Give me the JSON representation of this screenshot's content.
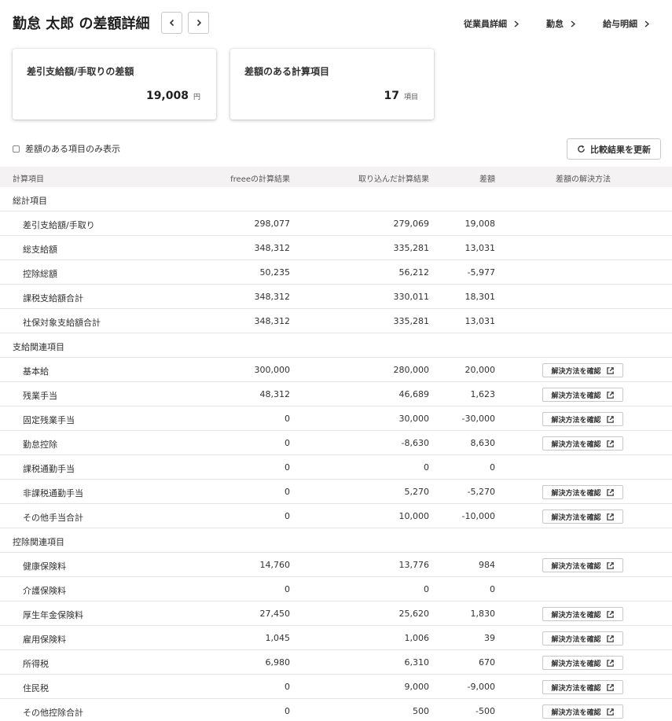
{
  "header": {
    "title": "勤怠 太郎 の差額詳細",
    "links": [
      "従業員詳細",
      "勤怠",
      "給与明細"
    ]
  },
  "cards": [
    {
      "label": "差引支給額/手取りの差額",
      "value": "19,008",
      "unit": "円"
    },
    {
      "label": "差額のある計算項目",
      "value": "17",
      "unit": "項目"
    }
  ],
  "filter": {
    "label": "差額のある項目のみ表示"
  },
  "refresh": {
    "label": "比較結果を更新"
  },
  "table": {
    "headers": [
      "計算項目",
      "freeeの計算結果",
      "取り込んだ計算結果",
      "差額",
      "差額の解決方法"
    ],
    "resolve_label": "解決方法を確認",
    "rows": [
      {
        "type": "group",
        "label": "総計項目"
      },
      {
        "type": "item",
        "label": "差引支給額/手取り",
        "freee": "298,077",
        "imported": "279,069",
        "diff": "19,008",
        "resolve": false
      },
      {
        "type": "item",
        "label": "総支給額",
        "freee": "348,312",
        "imported": "335,281",
        "diff": "13,031",
        "resolve": false
      },
      {
        "type": "item",
        "label": "控除総額",
        "freee": "50,235",
        "imported": "56,212",
        "diff": "-5,977",
        "resolve": false
      },
      {
        "type": "item",
        "label": "課税支給額合計",
        "freee": "348,312",
        "imported": "330,011",
        "diff": "18,301",
        "resolve": false
      },
      {
        "type": "item",
        "label": "社保対象支給額合計",
        "freee": "348,312",
        "imported": "335,281",
        "diff": "13,031",
        "resolve": false
      },
      {
        "type": "group",
        "label": "支給関連項目"
      },
      {
        "type": "item",
        "label": "基本給",
        "freee": "300,000",
        "imported": "280,000",
        "diff": "20,000",
        "resolve": true
      },
      {
        "type": "item",
        "label": "残業手当",
        "freee": "48,312",
        "imported": "46,689",
        "diff": "1,623",
        "resolve": true
      },
      {
        "type": "item",
        "label": "固定残業手当",
        "freee": "0",
        "imported": "30,000",
        "diff": "-30,000",
        "resolve": true
      },
      {
        "type": "item",
        "label": "勤怠控除",
        "freee": "0",
        "imported": "-8,630",
        "diff": "8,630",
        "resolve": true
      },
      {
        "type": "item",
        "label": "課税通勤手当",
        "freee": "0",
        "imported": "0",
        "diff": "0",
        "resolve": false
      },
      {
        "type": "item",
        "label": "非課税通勤手当",
        "freee": "0",
        "imported": "5,270",
        "diff": "-5,270",
        "resolve": true
      },
      {
        "type": "item",
        "label": "その他手当合計",
        "freee": "0",
        "imported": "10,000",
        "diff": "-10,000",
        "resolve": true
      },
      {
        "type": "group",
        "label": "控除関連項目"
      },
      {
        "type": "item",
        "label": "健康保険料",
        "freee": "14,760",
        "imported": "13,776",
        "diff": "984",
        "resolve": true
      },
      {
        "type": "item",
        "label": "介護保険料",
        "freee": "0",
        "imported": "0",
        "diff": "0",
        "resolve": false
      },
      {
        "type": "item",
        "label": "厚生年金保険料",
        "freee": "27,450",
        "imported": "25,620",
        "diff": "1,830",
        "resolve": true
      },
      {
        "type": "item",
        "label": "雇用保険料",
        "freee": "1,045",
        "imported": "1,006",
        "diff": "39",
        "resolve": true
      },
      {
        "type": "item",
        "label": "所得税",
        "freee": "6,980",
        "imported": "6,310",
        "diff": "670",
        "resolve": true
      },
      {
        "type": "item",
        "label": "住民税",
        "freee": "0",
        "imported": "9,000",
        "diff": "-9,000",
        "resolve": true
      },
      {
        "type": "item",
        "label": "その他控除合計",
        "freee": "0",
        "imported": "500",
        "diff": "-500",
        "resolve": true
      }
    ]
  },
  "icons": {
    "prev": "chevron-left-icon",
    "next": "chevron-right-icon",
    "refresh": "refresh-icon",
    "external": "external-link-icon"
  }
}
